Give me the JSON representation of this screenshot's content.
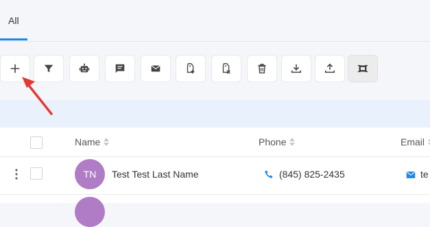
{
  "tabs": {
    "all_label": "All"
  },
  "toolbar": {
    "buttons": [
      {
        "name": "add-button",
        "icon": "plus-icon"
      },
      {
        "name": "filter-button",
        "icon": "filter-icon"
      },
      {
        "name": "robot-button",
        "icon": "robot-icon"
      },
      {
        "name": "message-button",
        "icon": "message-icon"
      },
      {
        "name": "email-button",
        "icon": "envelope-icon"
      },
      {
        "name": "add-tag-button",
        "icon": "tag-plus-icon"
      },
      {
        "name": "remove-tag-button",
        "icon": "tag-remove-icon"
      },
      {
        "name": "delete-button",
        "icon": "trash-icon"
      },
      {
        "name": "download-button",
        "icon": "download-icon"
      },
      {
        "name": "upload-button",
        "icon": "upload-icon"
      },
      {
        "name": "dedupe-button",
        "icon": "merge-icon"
      }
    ]
  },
  "table": {
    "columns": {
      "name": "Name",
      "phone": "Phone",
      "email": "Email"
    },
    "rows": [
      {
        "initials": "TN",
        "name": "Test Test Last Name",
        "phone": "(845) 825-2435",
        "email": "te"
      }
    ]
  },
  "colors": {
    "accent": "#1e88e5",
    "avatar": "#b07cc6",
    "annotation_arrow": "#e53935"
  }
}
